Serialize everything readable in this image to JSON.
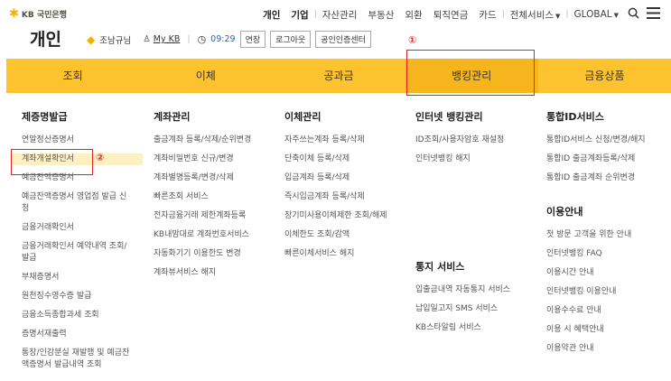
{
  "logo": {
    "text": "KB 국민은행"
  },
  "topnav": {
    "items": [
      "개인",
      "기업",
      "자산관리",
      "부동산",
      "외환",
      "퇴직연금",
      "카드",
      "전체서비스",
      "GLOBAL"
    ]
  },
  "header": {
    "title": "개인",
    "user_name": "조남규님",
    "my_kb": "My KB",
    "time": "09:29",
    "extend": "연장",
    "logout": "로그아웃",
    "cert_center": "공인인증센터"
  },
  "annotations": {
    "one": "①",
    "two": "②"
  },
  "mainnav": {
    "tabs": [
      "조회",
      "이체",
      "공과금",
      "뱅킹관리",
      "금융상품"
    ]
  },
  "menu": {
    "col1": {
      "title": "제증명발급",
      "items": [
        "연말정산증명서",
        "계좌개설확인서",
        "예금잔액증명서",
        "예금잔액증명서 영업점 발급 신청",
        "금융거래확인서",
        "금융거래확인서 예약내역 조회/발급",
        "부채증명서",
        "원천징수영수증 발급",
        "금융소득종합과세 조회",
        "증명서재출력",
        "통장/인감분실 재발행 및 예금잔액증명서 발급내역 조회"
      ]
    },
    "col2": {
      "title": "계좌관리",
      "items": [
        "출금계좌 등록/삭제/순위변경",
        "계좌비밀번호 신규/변경",
        "계좌별명등록/변경/삭제",
        "빠른조회 서비스",
        "전자금융거래 제한계좌등록",
        "KB내맘대로 계좌번호서비스",
        "자동화기기 이용한도 변경",
        "계좌뷰서비스 해지"
      ]
    },
    "col3": {
      "title": "이체관리",
      "items": [
        "자주쓰는계좌 등록/삭제",
        "단축이체 등록/삭제",
        "입금계좌 등록/삭제",
        "즉시입금계좌 등록/삭제",
        "장기미사용이체제한 조회/해제",
        "이체한도 조회/감액",
        "빠른이체서비스 해지"
      ]
    },
    "col4": {
      "title": "인터넷 뱅킹관리",
      "items": [
        "ID조회/사용자암호 재설정",
        "인터넷뱅킹 해지"
      ],
      "title2": "통지 서비스",
      "items2": [
        "입출금내역 자동통지 서비스",
        "납입일고지 SMS 서비스",
        "KB스타알림 서비스"
      ]
    },
    "col5": {
      "title": "통합ID서비스",
      "items": [
        "통합ID서비스 신청/변경/해지",
        "통합ID 출금계좌등록/삭제",
        "통합ID 출금계좌 순위변경"
      ],
      "title2": "이용안내",
      "items2": [
        "첫 방문 고객을 위한 안내",
        "인터넷뱅킹 FAQ",
        "이용시간 안내",
        "인터넷뱅킹 이용안내",
        "이용수수료 안내",
        "이용 시 혜택안내",
        "이용약관 안내"
      ]
    }
  }
}
